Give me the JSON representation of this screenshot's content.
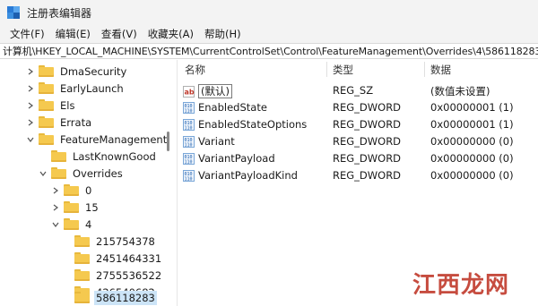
{
  "window": {
    "title": "注册表编辑器"
  },
  "menu": [
    "文件(F)",
    "编辑(E)",
    "查看(V)",
    "收藏夹(A)",
    "帮助(H)"
  ],
  "address": "计算机\\HKEY_LOCAL_MACHINE\\SYSTEM\\CurrentControlSet\\Control\\FeatureManagement\\Overrides\\4\\586118283",
  "tree": {
    "items": [
      {
        "label": "DmaSecurity",
        "expander": "collapsed"
      },
      {
        "label": "EarlyLaunch",
        "expander": "collapsed"
      },
      {
        "label": "Els",
        "expander": "collapsed"
      },
      {
        "label": "Errata",
        "expander": "collapsed"
      },
      {
        "label": "FeatureManagement",
        "expander": "expanded"
      },
      {
        "label": "LastKnownGood",
        "expander": "none"
      },
      {
        "label": "Overrides",
        "expander": "expanded"
      },
      {
        "label": "0",
        "expander": "collapsed"
      },
      {
        "label": "15",
        "expander": "collapsed"
      },
      {
        "label": "4",
        "expander": "expanded"
      },
      {
        "label": "215754378",
        "expander": "none"
      },
      {
        "label": "2451464331",
        "expander": "none"
      },
      {
        "label": "2755536522",
        "expander": "none"
      },
      {
        "label": "426540682",
        "expander": "none"
      },
      {
        "label": "586118283",
        "expander": "none",
        "selected": true
      }
    ]
  },
  "list": {
    "columns": [
      "名称",
      "类型",
      "数据"
    ],
    "rows": [
      {
        "name": "(默认)",
        "type": "REG_SZ",
        "data": "(数值未设置)",
        "icon": "string-value-icon"
      },
      {
        "name": "EnabledState",
        "type": "REG_DWORD",
        "data": "0x00000001 (1)",
        "icon": "dword-value-icon"
      },
      {
        "name": "EnabledStateOptions",
        "type": "REG_DWORD",
        "data": "0x00000001 (1)",
        "icon": "dword-value-icon"
      },
      {
        "name": "Variant",
        "type": "REG_DWORD",
        "data": "0x00000000 (0)",
        "icon": "dword-value-icon"
      },
      {
        "name": "VariantPayload",
        "type": "REG_DWORD",
        "data": "0x00000000 (0)",
        "icon": "dword-value-icon"
      },
      {
        "name": "VariantPayloadKind",
        "type": "REG_DWORD",
        "data": "0x00000000 (0)",
        "icon": "dword-value-icon"
      }
    ]
  },
  "watermark": {
    "text": "江西龙网"
  },
  "colors": {
    "selection": "#cce4f7",
    "folder": "#f5c94f",
    "accent": "#2a7bd6",
    "watermark": "#c0392b"
  }
}
